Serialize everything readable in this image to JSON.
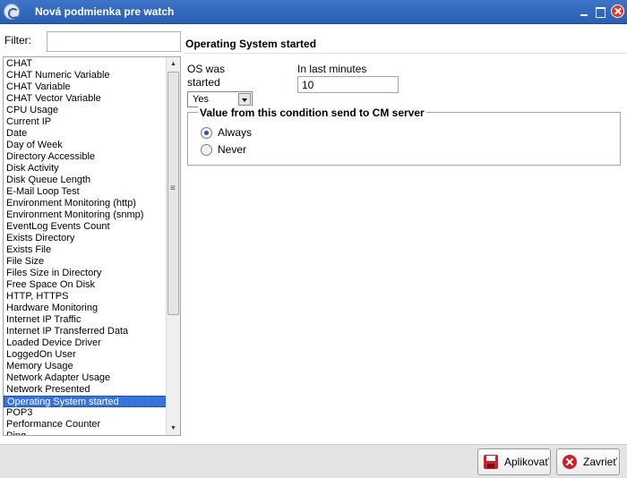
{
  "window": {
    "title": "Nová podmienka pre watch",
    "icon": "app-logo-icon"
  },
  "filter": {
    "label": "Filter:",
    "value": ""
  },
  "list": {
    "items": [
      "CHAT",
      "CHAT Numeric Variable",
      "CHAT Variable",
      "CHAT Vector Variable",
      "CPU Usage",
      "Current IP",
      "Date",
      "Day of Week",
      "Directory Accessible",
      "Disk Activity",
      "Disk Queue Length",
      "E-Mail Loop Test",
      "Environment Monitoring (http)",
      "Environment Monitoring (snmp)",
      "EventLog Events Count",
      "Exists Directory",
      "Exists File",
      "File Size",
      "Files Size in Directory",
      "Free Space On Disk",
      "HTTP, HTTPS",
      "Hardware Monitoring",
      "Internet IP Traffic",
      "Internet IP Transferred Data",
      "Loaded Device Driver",
      "LoggedOn User",
      "Memory Usage",
      "Network Adapter Usage",
      "Network Presented",
      "Operating System started",
      "POP3",
      "Performance Counter",
      "Ping"
    ],
    "selected_index": 29
  },
  "pane": {
    "title": "Operating System started",
    "os_label": "OS was started",
    "os_value": "Yes",
    "minutes_label": "In last minutes",
    "minutes_value": "10",
    "group_legend": "Value from this condition send to CM server",
    "radio_always": "Always",
    "radio_never": "Never",
    "selected_radio": "Always"
  },
  "footer": {
    "apply_label": "Aplikovať",
    "close_label": "Zavrieť"
  },
  "colors": {
    "titlebar": "#2a5eb2",
    "selection": "#3a73d6",
    "button_icon": "#c8232c"
  }
}
